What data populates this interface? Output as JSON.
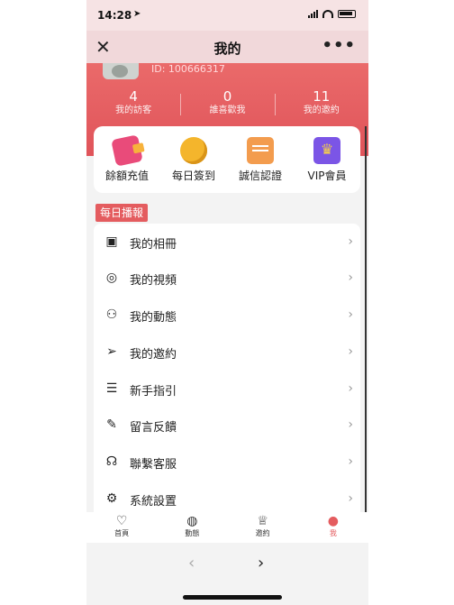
{
  "status_bar": {
    "time": "14:28"
  },
  "nav": {
    "title": "我的",
    "close_glyph": "✕",
    "more_glyph": "•••"
  },
  "profile": {
    "id_text": "ID: 100666317",
    "stats": [
      {
        "value": "4",
        "label": "我的訪客"
      },
      {
        "value": "0",
        "label": "誰喜歡我"
      },
      {
        "value": "11",
        "label": "我的邀約"
      }
    ]
  },
  "quick_actions": [
    {
      "label": "餘額充值",
      "icon": "wallet-icon"
    },
    {
      "label": "每日簽到",
      "icon": "coin-icon"
    },
    {
      "label": "誠信認證",
      "icon": "certificate-icon"
    },
    {
      "label": "VIP會員",
      "icon": "vip-crown-icon"
    }
  ],
  "section_tag": "每日播報",
  "menu": [
    {
      "label": "我的相冊",
      "icon": "album-icon",
      "glyph": "▣"
    },
    {
      "label": "我的視頻",
      "icon": "video-icon",
      "glyph": "◎"
    },
    {
      "label": "我的動態",
      "icon": "moments-icon",
      "glyph": "⚇"
    },
    {
      "label": "我的邀約",
      "icon": "send-icon",
      "glyph": "➢"
    },
    {
      "label": "新手指引",
      "icon": "guide-icon",
      "glyph": "☰"
    },
    {
      "label": "留言反饋",
      "icon": "feedback-icon",
      "glyph": "✎"
    },
    {
      "label": "聯繫客服",
      "icon": "support-icon",
      "glyph": "☊"
    },
    {
      "label": "系統設置",
      "icon": "settings-icon",
      "glyph": "⚙"
    }
  ],
  "chevron": "›",
  "tabs": [
    {
      "label": "首頁",
      "icon": "heart-icon",
      "glyph": "♡"
    },
    {
      "label": "動態",
      "icon": "planet-icon",
      "glyph": "◍"
    },
    {
      "label": "邀約",
      "icon": "trophy-icon",
      "glyph": "♕"
    },
    {
      "label": "我",
      "icon": "profile-icon",
      "glyph": "●",
      "active": true
    }
  ],
  "browser": {
    "back": "‹",
    "forward": "›"
  },
  "colors": {
    "accent": "#e45c5f",
    "header_red": "#e0545a"
  }
}
